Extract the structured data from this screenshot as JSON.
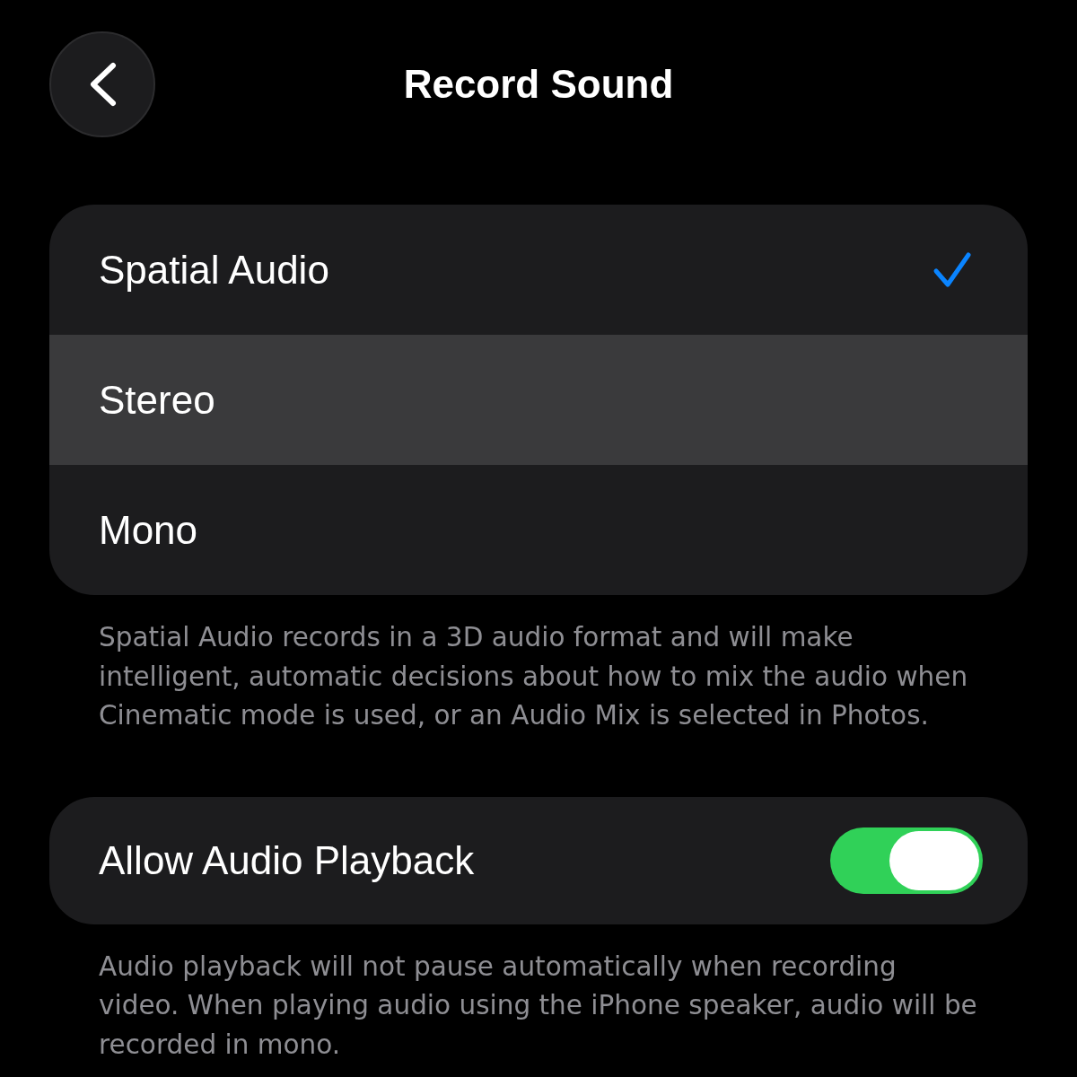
{
  "header": {
    "title": "Record Sound"
  },
  "options": [
    {
      "label": "Spatial Audio",
      "selected": true,
      "highlighted": false
    },
    {
      "label": "Stereo",
      "selected": false,
      "highlighted": true
    },
    {
      "label": "Mono",
      "selected": false,
      "highlighted": false
    }
  ],
  "options_footer": "Spatial Audio records in a 3D audio format and will make intelligent, automatic decisions about how to mix the audio when Cinematic mode is used, or an Audio Mix is selected in Photos.",
  "playback": {
    "label": "Allow Audio Playback",
    "on": true
  },
  "playback_footer": "Audio playback will not pause automatically when recording video. When playing audio using the iPhone speaker, audio will be recorded in mono."
}
